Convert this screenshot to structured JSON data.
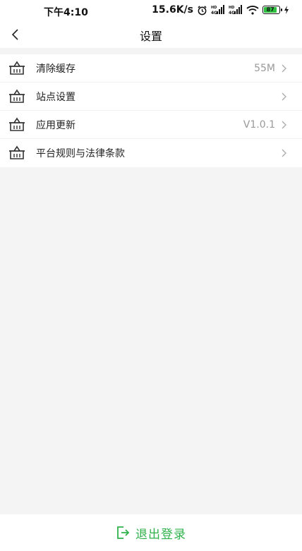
{
  "status_bar": {
    "time": "下午4:10",
    "net_speed": "15.6K/s",
    "battery_level": "87"
  },
  "nav": {
    "title": "设置"
  },
  "menu": {
    "items": [
      {
        "label": "清除缓存",
        "value": "55M",
        "icon": "basket-icon"
      },
      {
        "label": "站点设置",
        "value": "",
        "icon": "basket-icon"
      },
      {
        "label": "应用更新",
        "value": "V1.0.1",
        "icon": "basket-icon"
      },
      {
        "label": "平台规则与法律条款",
        "value": "",
        "icon": "basket-icon"
      }
    ]
  },
  "logout": {
    "label": "退出登录",
    "icon": "logout-icon",
    "color": "#2fb24b"
  }
}
